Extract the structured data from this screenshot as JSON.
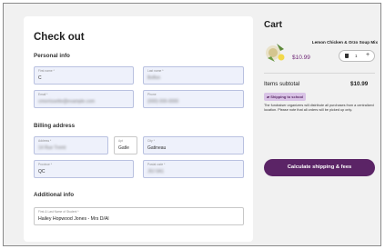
{
  "checkout": {
    "title": "Check out",
    "personal_info": {
      "heading": "Personal info",
      "first_name": {
        "label": "First name *",
        "value": "C"
      },
      "last_name": {
        "label": "Last name *",
        "value": "Boflon"
      },
      "email": {
        "label": "Email *",
        "value": "cmorrissette@example.com"
      },
      "phone": {
        "label": "Phone",
        "value": "(000) 000-0000"
      }
    },
    "billing": {
      "heading": "Billing address",
      "address": {
        "label": "Address *",
        "value": "14 Rue Tremt"
      },
      "apt": {
        "label": "Apt",
        "value": "Gatle"
      },
      "city": {
        "label": "City *",
        "value": "Gatineau"
      },
      "province": {
        "label": "Province *",
        "value": "QC"
      },
      "postal_code": {
        "label": "Postal code *",
        "value": "J9J 0A1"
      }
    },
    "additional": {
      "heading": "Additional info",
      "student": {
        "label": "First & Last Name of Student *",
        "value": "Hailey Hopwood Jones - Mrs D/Al"
      }
    }
  },
  "cart": {
    "title": "Cart",
    "item": {
      "name": "Lemon Chicken & Orzo Soup Mix",
      "price": "$10.99",
      "qty": "1",
      "icon": "soup-mix-product-image"
    },
    "subtotal_label": "Items subtotal",
    "subtotal_value": "$10.99",
    "badge": "Shipping to school",
    "notice": "The fundraiser organizers will distribute all purchases from a centralized location. Please note that all orders will be picked up only.",
    "calc_button": "Calculate shipping & fees"
  },
  "colors": {
    "accent": "#5b2466",
    "field_bg": "#eef1fb",
    "badge_bg": "#d9c3e6"
  }
}
